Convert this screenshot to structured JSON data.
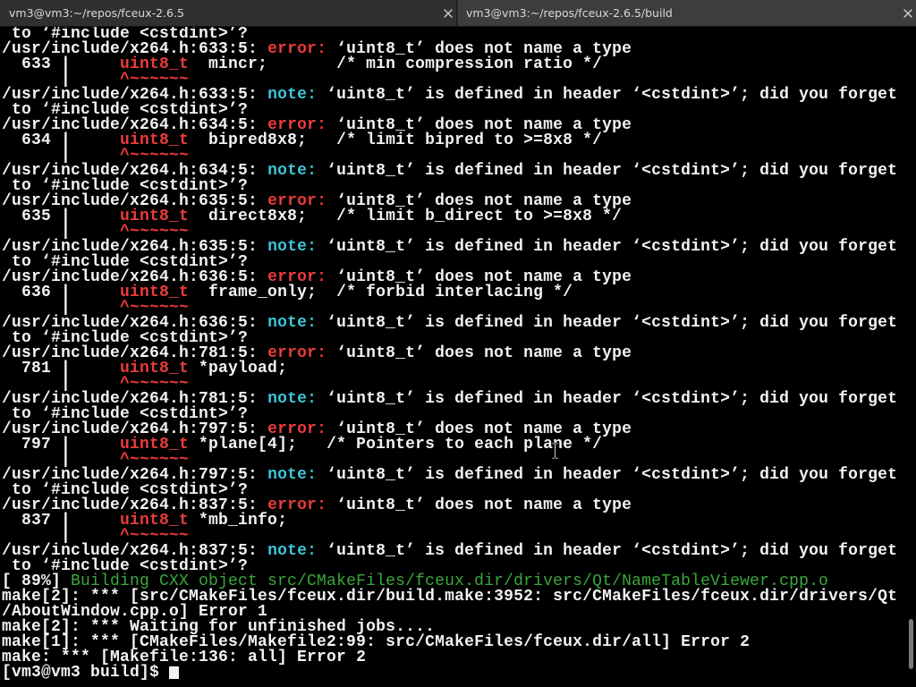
{
  "theme": {
    "background": "#000000",
    "text": "#f2f2f2",
    "error": "#ec3b3b",
    "note": "#3ec4d8",
    "green": "#3aa83a",
    "tab_inactive": "#303030",
    "tab_active": "#3d3d3d",
    "tab_text": "#d8d8d8",
    "scrollbar_thumb": "#7a7a7a"
  },
  "tabs": [
    {
      "title": "vm3@vm3:~/repos/fceux-2.6.5",
      "active": false,
      "close_icon": "close-icon"
    },
    {
      "title": "vm3@vm3:~/repos/fceux-2.6.5/build",
      "active": true,
      "close_icon": "close-icon"
    }
  ],
  "terminal": {
    "lines": [
      [
        {
          "style": "text",
          "text": " to ‘#include <cstdint>’?"
        }
      ],
      [
        {
          "style": "text",
          "text": "/usr/include/x264.h:633:5: "
        },
        {
          "style": "error",
          "text": "error:"
        },
        {
          "style": "text",
          "text": " ‘uint8_t’ does not name a type"
        }
      ],
      [
        {
          "style": "text",
          "text": "  633 |     "
        },
        {
          "style": "error",
          "text": "uint8_t"
        },
        {
          "style": "text",
          "text": "  mincr;       /* min compression ratio */"
        }
      ],
      [
        {
          "style": "text",
          "text": "      |     "
        },
        {
          "style": "error",
          "text": "^~~~~~~"
        }
      ],
      [
        {
          "style": "text",
          "text": "/usr/include/x264.h:633:5: "
        },
        {
          "style": "note",
          "text": "note:"
        },
        {
          "style": "text",
          "text": " ‘uint8_t’ is defined in header ‘<cstdint>’; did you forget"
        }
      ],
      [
        {
          "style": "text",
          "text": " to ‘#include <cstdint>’?"
        }
      ],
      [
        {
          "style": "text",
          "text": "/usr/include/x264.h:634:5: "
        },
        {
          "style": "error",
          "text": "error:"
        },
        {
          "style": "text",
          "text": " ‘uint8_t’ does not name a type"
        }
      ],
      [
        {
          "style": "text",
          "text": "  634 |     "
        },
        {
          "style": "error",
          "text": "uint8_t"
        },
        {
          "style": "text",
          "text": "  bipred8x8;   /* limit bipred to >=8x8 */"
        }
      ],
      [
        {
          "style": "text",
          "text": "      |     "
        },
        {
          "style": "error",
          "text": "^~~~~~~"
        }
      ],
      [
        {
          "style": "text",
          "text": "/usr/include/x264.h:634:5: "
        },
        {
          "style": "note",
          "text": "note:"
        },
        {
          "style": "text",
          "text": " ‘uint8_t’ is defined in header ‘<cstdint>’; did you forget"
        }
      ],
      [
        {
          "style": "text",
          "text": " to ‘#include <cstdint>’?"
        }
      ],
      [
        {
          "style": "text",
          "text": "/usr/include/x264.h:635:5: "
        },
        {
          "style": "error",
          "text": "error:"
        },
        {
          "style": "text",
          "text": " ‘uint8_t’ does not name a type"
        }
      ],
      [
        {
          "style": "text",
          "text": "  635 |     "
        },
        {
          "style": "error",
          "text": "uint8_t"
        },
        {
          "style": "text",
          "text": "  direct8x8;   /* limit b_direct to >=8x8 */"
        }
      ],
      [
        {
          "style": "text",
          "text": "      |     "
        },
        {
          "style": "error",
          "text": "^~~~~~~"
        }
      ],
      [
        {
          "style": "text",
          "text": "/usr/include/x264.h:635:5: "
        },
        {
          "style": "note",
          "text": "note:"
        },
        {
          "style": "text",
          "text": " ‘uint8_t’ is defined in header ‘<cstdint>’; did you forget"
        }
      ],
      [
        {
          "style": "text",
          "text": " to ‘#include <cstdint>’?"
        }
      ],
      [
        {
          "style": "text",
          "text": "/usr/include/x264.h:636:5: "
        },
        {
          "style": "error",
          "text": "error:"
        },
        {
          "style": "text",
          "text": " ‘uint8_t’ does not name a type"
        }
      ],
      [
        {
          "style": "text",
          "text": "  636 |     "
        },
        {
          "style": "error",
          "text": "uint8_t"
        },
        {
          "style": "text",
          "text": "  frame_only;  /* forbid interlacing */"
        }
      ],
      [
        {
          "style": "text",
          "text": "      |     "
        },
        {
          "style": "error",
          "text": "^~~~~~~"
        }
      ],
      [
        {
          "style": "text",
          "text": "/usr/include/x264.h:636:5: "
        },
        {
          "style": "note",
          "text": "note:"
        },
        {
          "style": "text",
          "text": " ‘uint8_t’ is defined in header ‘<cstdint>’; did you forget"
        }
      ],
      [
        {
          "style": "text",
          "text": " to ‘#include <cstdint>’?"
        }
      ],
      [
        {
          "style": "text",
          "text": "/usr/include/x264.h:781:5: "
        },
        {
          "style": "error",
          "text": "error:"
        },
        {
          "style": "text",
          "text": " ‘uint8_t’ does not name a type"
        }
      ],
      [
        {
          "style": "text",
          "text": "  781 |     "
        },
        {
          "style": "error",
          "text": "uint8_t"
        },
        {
          "style": "text",
          "text": " *payload;"
        }
      ],
      [
        {
          "style": "text",
          "text": "      |     "
        },
        {
          "style": "error",
          "text": "^~~~~~~"
        }
      ],
      [
        {
          "style": "text",
          "text": "/usr/include/x264.h:781:5: "
        },
        {
          "style": "note",
          "text": "note:"
        },
        {
          "style": "text",
          "text": " ‘uint8_t’ is defined in header ‘<cstdint>’; did you forget"
        }
      ],
      [
        {
          "style": "text",
          "text": " to ‘#include <cstdint>’?"
        }
      ],
      [
        {
          "style": "text",
          "text": "/usr/include/x264.h:797:5: "
        },
        {
          "style": "error",
          "text": "error:"
        },
        {
          "style": "text",
          "text": " ‘uint8_t’ does not name a type"
        }
      ],
      [
        {
          "style": "text",
          "text": "  797 |     "
        },
        {
          "style": "error",
          "text": "uint8_t"
        },
        {
          "style": "text",
          "text": " *plane[4];   /* Pointers to each plane */"
        }
      ],
      [
        {
          "style": "text",
          "text": "      |     "
        },
        {
          "style": "error",
          "text": "^~~~~~~"
        }
      ],
      [
        {
          "style": "text",
          "text": "/usr/include/x264.h:797:5: "
        },
        {
          "style": "note",
          "text": "note:"
        },
        {
          "style": "text",
          "text": " ‘uint8_t’ is defined in header ‘<cstdint>’; did you forget"
        }
      ],
      [
        {
          "style": "text",
          "text": " to ‘#include <cstdint>’?"
        }
      ],
      [
        {
          "style": "text",
          "text": "/usr/include/x264.h:837:5: "
        },
        {
          "style": "error",
          "text": "error:"
        },
        {
          "style": "text",
          "text": " ‘uint8_t’ does not name a type"
        }
      ],
      [
        {
          "style": "text",
          "text": "  837 |     "
        },
        {
          "style": "error",
          "text": "uint8_t"
        },
        {
          "style": "text",
          "text": " *mb_info;"
        }
      ],
      [
        {
          "style": "text",
          "text": "      |     "
        },
        {
          "style": "error",
          "text": "^~~~~~~"
        }
      ],
      [
        {
          "style": "text",
          "text": "/usr/include/x264.h:837:5: "
        },
        {
          "style": "note",
          "text": "note:"
        },
        {
          "style": "text",
          "text": " ‘uint8_t’ is defined in header ‘<cstdint>’; did you forget"
        }
      ],
      [
        {
          "style": "text",
          "text": " to ‘#include <cstdint>’?"
        }
      ],
      [
        {
          "style": "text",
          "text": "[ 89%] "
        },
        {
          "style": "green",
          "text": "Building CXX object src/CMakeFiles/fceux.dir/drivers/Qt/NameTableViewer.cpp.o"
        }
      ],
      [
        {
          "style": "text",
          "text": "make[2]: *** [src/CMakeFiles/fceux.dir/build.make:3952: src/CMakeFiles/fceux.dir/drivers/Qt"
        }
      ],
      [
        {
          "style": "text",
          "text": "/AboutWindow.cpp.o] Error 1"
        }
      ],
      [
        {
          "style": "text",
          "text": "make[2]: *** Waiting for unfinished jobs...."
        }
      ],
      [
        {
          "style": "text",
          "text": "make[1]: *** [CMakeFiles/Makefile2:99: src/CMakeFiles/fceux.dir/all] Error 2"
        }
      ],
      [
        {
          "style": "text",
          "text": "make: *** [Makefile:136: all] Error 2"
        }
      ]
    ],
    "prompt": "[vm3@vm3 build]$ "
  },
  "scrollbar": {
    "position": 0.97,
    "visible_fraction": 0.076
  },
  "mouse_pointer_icon": "ibeam-cursor-icon"
}
